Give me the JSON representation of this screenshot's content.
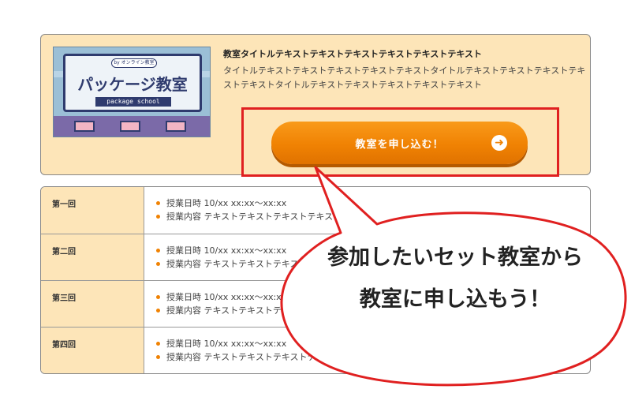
{
  "card": {
    "thumbnail": {
      "byline": "by オンライン教室",
      "title": "パッケージ教室",
      "subtitle": "package school"
    },
    "title": "教室タイトルテキストテキストテキストテキストテキストテキスト",
    "description": "タイトルテキストテキストテキストテキストテキストタイトルテキストテキストテキストテキストテキストタイトルテキストテキストテキストテキストテキスト",
    "apply_label": "教室を申し込む！",
    "apply_icon": "arrow-right-circle-icon"
  },
  "schedule": {
    "rows": [
      {
        "heading": "第一回",
        "date": "授業日時 10/xx xx:xx〜xx:xx",
        "content": "授業内容 テキストテキストテキストテキスト"
      },
      {
        "heading": "第二回",
        "date": "授業日時 10/xx xx:xx〜xx:xx",
        "content": "授業内容 テキストテキストテキストテキスト"
      },
      {
        "heading": "第三回",
        "date": "授業日時 10/xx xx:xx〜xx:xx",
        "content": "授業内容 テキストテキストテキストテキスト"
      },
      {
        "heading": "第四回",
        "date": "授業日時 10/xx xx:xx〜xx:xx",
        "content": "授業内容 テキストテキストテキストテキスト"
      }
    ]
  },
  "callout": {
    "line1": "参加したいセット教室から",
    "line2": "教室に申し込もう！"
  },
  "colors": {
    "accent": "#f08203",
    "card_bg": "#fde5b8",
    "highlight": "#e02020"
  }
}
